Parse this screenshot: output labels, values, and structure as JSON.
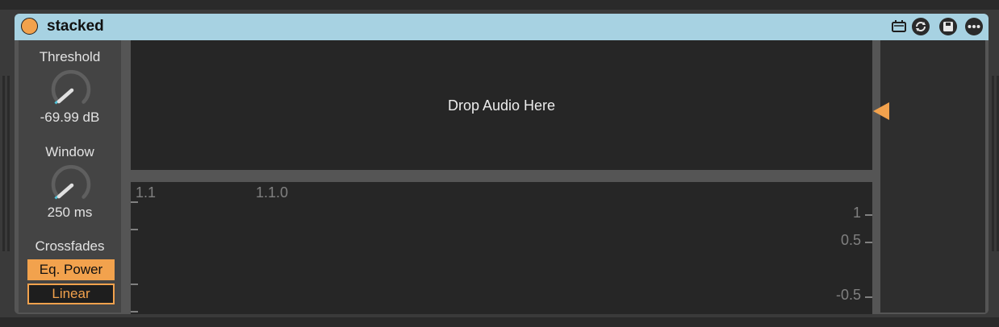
{
  "device": {
    "title": "stacked"
  },
  "threshold": {
    "label": "Threshold",
    "value": "-69.99 dB",
    "knob_position": 0.0
  },
  "window": {
    "label": "Window",
    "value": "250 ms",
    "knob_position": 0.0
  },
  "crossfades": {
    "label": "Crossfades",
    "options": [
      "Eq. Power",
      "Linear"
    ],
    "selected": "Eq. Power"
  },
  "drop_zone": {
    "text": "Drop Audio Here"
  },
  "waveform": {
    "time_labels": [
      "1.1",
      "1.1.0"
    ],
    "amplitude_labels": [
      "1",
      "0.5",
      "-0.5"
    ]
  },
  "colors": {
    "accent": "#f2a24d",
    "title_bar": "#a7d2e2",
    "knob_indicator": "#4fc3d9"
  },
  "icons": [
    "power-icon",
    "map-icon",
    "hot-swap-icon",
    "save-icon",
    "more-icon"
  ]
}
